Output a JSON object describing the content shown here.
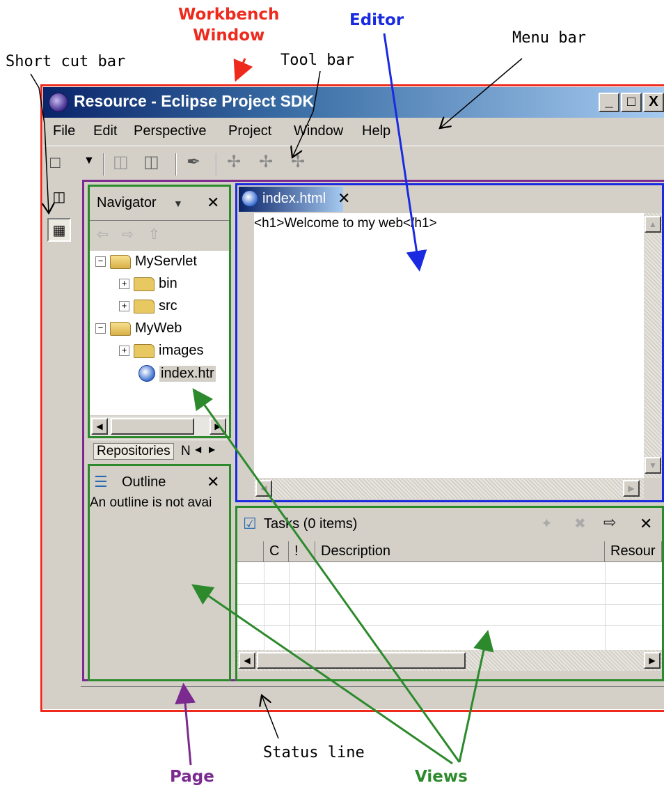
{
  "annotations": {
    "workbench_window": "Workbench\nWindow",
    "editor": "Editor",
    "menu_bar": "Menu bar",
    "short_cut_bar": "Short cut bar",
    "tool_bar": "Tool bar",
    "status_line": "Status line",
    "page": "Page",
    "views": "Views"
  },
  "colors": {
    "workbench": "#ee2a1d",
    "editor": "#1a2ae0",
    "page": "#7b2a8f",
    "views": "#2c8a2c",
    "status": "#000000"
  },
  "window": {
    "title": "Resource - Eclipse Project SDK",
    "controls": [
      "_",
      "□",
      "X"
    ]
  },
  "menu": [
    "File",
    "Edit",
    "Perspective",
    "Project",
    "Window",
    "Help"
  ],
  "navigator": {
    "title": "Navigator",
    "tree": [
      {
        "label": "MyServlet",
        "level": 0,
        "expander": "−",
        "icon": "folder-open"
      },
      {
        "label": "bin",
        "level": 1,
        "expander": "+",
        "icon": "folder"
      },
      {
        "label": "src",
        "level": 1,
        "expander": "+",
        "icon": "folder"
      },
      {
        "label": "MyWeb",
        "level": 0,
        "expander": "−",
        "icon": "folder-open"
      },
      {
        "label": "images",
        "level": 1,
        "expander": "+",
        "icon": "folder"
      },
      {
        "label": "index.htr",
        "level": 1,
        "expander": "",
        "icon": "html-file"
      }
    ],
    "bottom_tabs": [
      "Repositories",
      "N"
    ]
  },
  "outline": {
    "title": "Outline",
    "message": "An outline is not avai"
  },
  "editor_view": {
    "tab": "index.html",
    "content": "<h1>Welcome to my web</h1>"
  },
  "tasks": {
    "title": "Tasks (0 items)",
    "columns": [
      "C",
      "!",
      "Description",
      "Resour"
    ]
  }
}
